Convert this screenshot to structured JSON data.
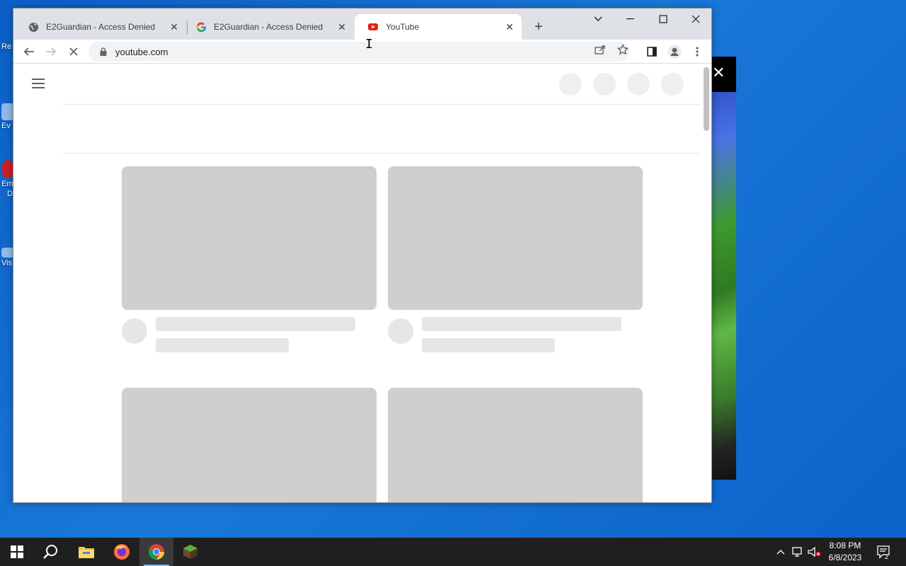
{
  "desktop": {
    "icons": [
      {
        "label": "Re"
      },
      {
        "label": "Ev"
      },
      {
        "label": "Em"
      },
      {
        "label": "D"
      },
      {
        "label": "Vis"
      }
    ]
  },
  "browser": {
    "tabs": [
      {
        "title": "E2Guardian - Access Denied",
        "icon": "globe-icon"
      },
      {
        "title": "E2Guardian - Access Denied",
        "icon": "google-icon"
      },
      {
        "title": "YouTube",
        "icon": "youtube-icon",
        "active": true
      }
    ],
    "new_tab": "+",
    "address": "youtube.com"
  },
  "taskbar": {
    "time": "8:08 PM",
    "date": "6/8/2023",
    "notifications": "2",
    "apps": [
      "start-icon",
      "search-icon",
      "file-explorer-icon",
      "firefox-icon",
      "chrome-icon",
      "minecraft-icon"
    ]
  },
  "colors": {
    "desktop": "#0b62c9",
    "tabstrip": "#dee1e6",
    "placeholder": "#cfcfcf",
    "taskbar": "#1f1f1f"
  }
}
